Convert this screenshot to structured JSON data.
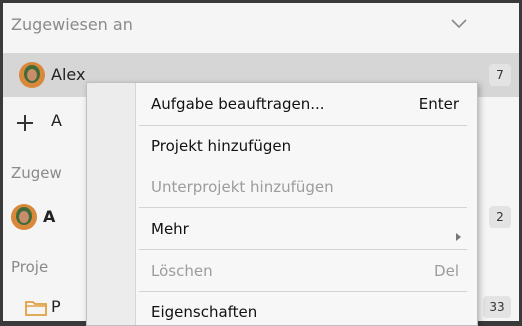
{
  "header": {
    "title": "Zugewiesen an"
  },
  "rows": {
    "alex": {
      "label": "Alex",
      "count": "7"
    },
    "add": {
      "label": "A"
    },
    "section_assigned": {
      "label": "Zugew"
    },
    "person2": {
      "label": "A",
      "count": "2"
    },
    "section_projects": {
      "label": "Proje"
    },
    "project1": {
      "label": "P",
      "count": "33"
    }
  },
  "context_menu": {
    "items": [
      {
        "label": "Aufgabe beauftragen...",
        "shortcut": "Enter",
        "enabled": true
      },
      {
        "label": "Projekt hinzufügen",
        "enabled": true
      },
      {
        "label": "Unterprojekt hinzufügen",
        "enabled": false
      },
      {
        "label": "Mehr",
        "enabled": true,
        "submenu": true
      },
      {
        "label": "Löschen",
        "shortcut": "Del",
        "enabled": false
      },
      {
        "label": "Eigenschaften",
        "enabled": true
      }
    ]
  },
  "colors": {
    "panel": "#f5f5f5",
    "selected_row": "#d6d6d6",
    "folder": "#e0a040"
  },
  "icons": [
    "chevron-down-icon",
    "avatar-icon",
    "plus-icon",
    "folder-icon",
    "submenu-arrow-icon"
  ]
}
